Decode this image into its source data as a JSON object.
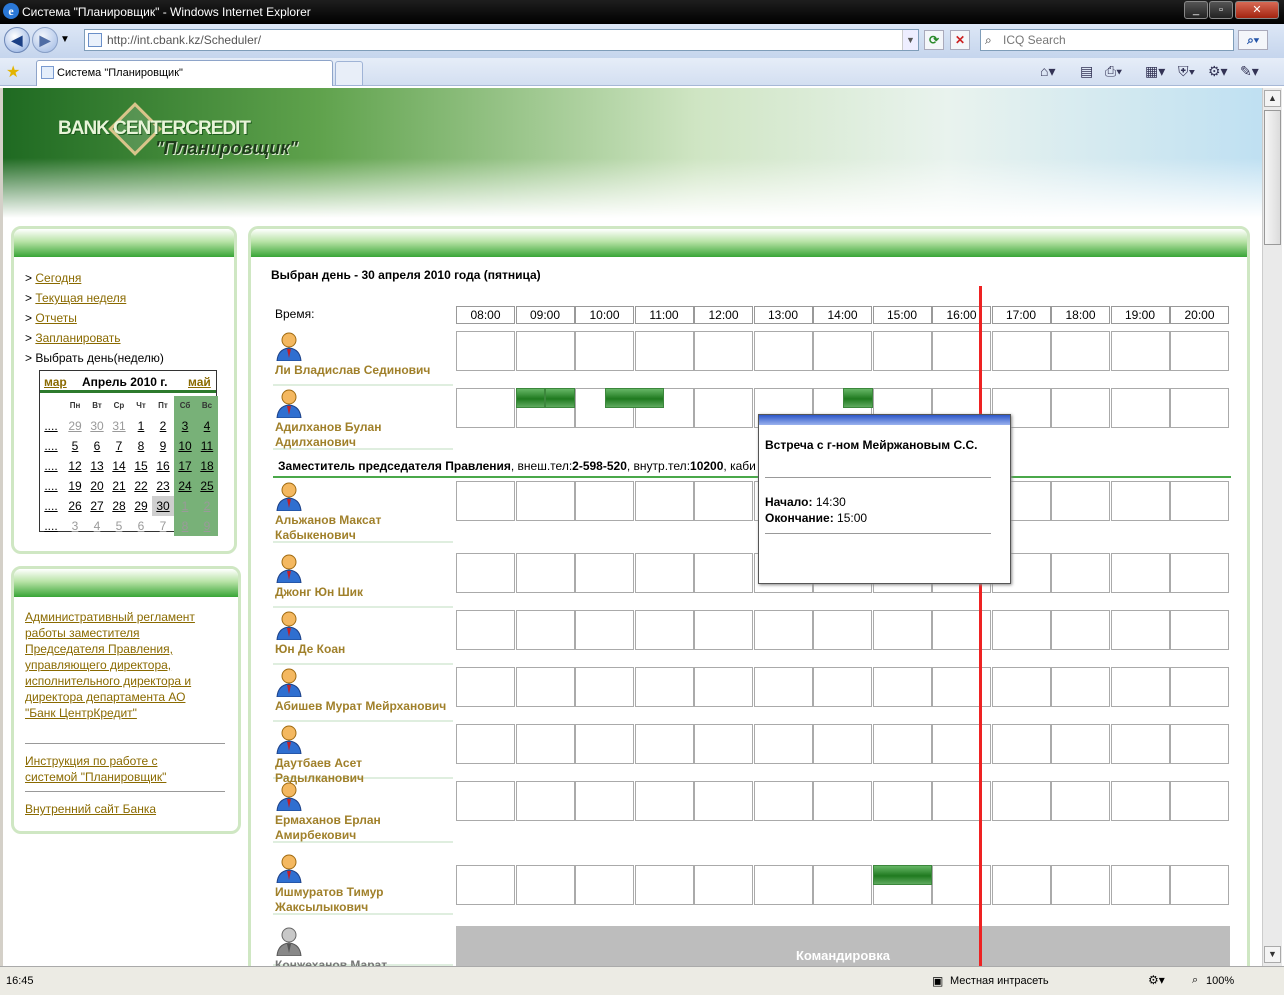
{
  "window": {
    "title": "Система \"Планировщик\" - Windows Internet Explorer"
  },
  "browser": {
    "address": "http://int.cbank.kz/Scheduler/",
    "search_placeholder": "ICQ Search",
    "tab_title": "Система \"Планировщик\""
  },
  "header": {
    "logo_text": "BANK CENTERCREDIT",
    "app_title": "\"Планировщик\""
  },
  "nav": {
    "prefix": ">",
    "today": "Сегодня",
    "week": "Текущая неделя",
    "reports": "Отчеты",
    "plan": "Запланировать",
    "pick_day": "Выбрать день(неделю)"
  },
  "calendar": {
    "prev": "мар",
    "month": "Апрель 2010 г.",
    "next": "май",
    "weekdays": [
      "Пн",
      "Вт",
      "Ср",
      "Чт",
      "Пт",
      "Сб",
      "Вс"
    ],
    "week_link": "....",
    "rows": [
      [
        "29",
        "30",
        "31",
        "1",
        "2",
        "3",
        "4"
      ],
      [
        "5",
        "6",
        "7",
        "8",
        "9",
        "10",
        "11"
      ],
      [
        "12",
        "13",
        "14",
        "15",
        "16",
        "17",
        "18"
      ],
      [
        "19",
        "20",
        "21",
        "22",
        "23",
        "24",
        "25"
      ],
      [
        "26",
        "27",
        "28",
        "29",
        "30",
        "1",
        "2"
      ],
      [
        "3",
        "4",
        "5",
        "6",
        "7",
        "8",
        "9"
      ]
    ],
    "selected": "30"
  },
  "docs": {
    "regulation": "Административный регламент работы заместителя Председателя Правления, управляющего директора, исполнительного директора и директора департамента АО \"Банк ЦентрКредит\"",
    "manual": "Инструкция по работе с системой \"Планировщик\"",
    "intranet": "Внутренний сайт Банка"
  },
  "schedule": {
    "day_title": "Выбран день - 30 апреля 2010 года (пятница)",
    "time_label": "Время:",
    "hours": [
      "08:00",
      "09:00",
      "10:00",
      "11:00",
      "12:00",
      "13:00",
      "14:00",
      "15:00",
      "16:00",
      "17:00",
      "18:00",
      "19:00",
      "20:00"
    ],
    "dept": {
      "title": "Заместитель председателя Правления",
      "ext_label": ", внеш.тел:",
      "ext_phone": "2-598-520",
      "int_label": ", внутр.тел:",
      "int_phone": "10200",
      "office_label": ", каби"
    },
    "people": [
      "Ли Владислав Сединович",
      "Адилханов Булан Адилханович",
      "Альжанов Максат Кабыкенович",
      "Джонг Юн Шик",
      "Юн Де Коан",
      "Абишев Мурат Мейрханович",
      "Даутбаев Асет Радылканович",
      "Ермаханов Ерлан Амирбекович",
      "Ишмуратов Тимур Жаксылыкович",
      "Конжеханов Марат"
    ],
    "trip_label": "Командировка"
  },
  "popup": {
    "title": "Встреча с г-ном Мейржановым С.С.",
    "start_label": "Начало:",
    "start_value": "14:30",
    "end_label": "Окончание:",
    "end_value": "15:00"
  },
  "statusbar": {
    "time": "16:45",
    "zone": "Местная интрасеть",
    "zoom": "100%"
  },
  "colors": {
    "accent_green": "#38a536",
    "link": "#8a6a00",
    "now_line": "#ee2222"
  }
}
